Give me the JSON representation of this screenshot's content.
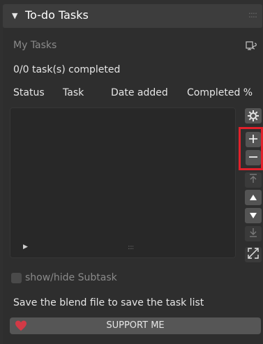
{
  "header": {
    "title": "To-do Tasks"
  },
  "list_name": "My Tasks",
  "progress_text": "0/0 task(s) completed",
  "columns": [
    "Status",
    "Task",
    "Date added",
    "Completed %"
  ],
  "checkbox_label": "show/hide Subtask",
  "hint_text": "Save the blend file to save the task list",
  "support_label": "SUPPORT ME",
  "colors": {
    "highlight": "#e0212b",
    "heart": "#d23a46"
  },
  "icons": {
    "gear": "gear-icon",
    "add": "plus-icon",
    "remove": "minus-icon",
    "move_top": "move-to-top-icon",
    "move_up": "triangle-up-icon",
    "move_down": "triangle-down-icon",
    "move_bottom": "move-to-bottom-icon",
    "expand": "expand-icon",
    "new_window": "new-window-icon"
  }
}
